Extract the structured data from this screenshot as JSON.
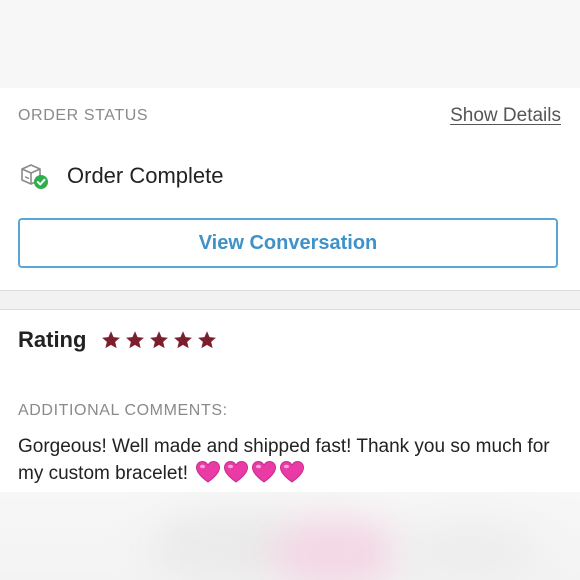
{
  "order": {
    "status_label": "ORDER STATUS",
    "show_details_label": "Show Details",
    "status_text": "Order Complete",
    "status_icon": "package-check-icon",
    "view_conversation_label": "View Conversation"
  },
  "review": {
    "rating_label": "Rating",
    "rating_value": 5,
    "rating_max": 5,
    "star_color": "#7a1f2b",
    "comments_label": "ADDITIONAL COMMENTS:",
    "comment_text": "Gorgeous! Well made and shipped fast! Thank you so much for my custom bracelet!",
    "comment_emoji": [
      "pink-heart",
      "pink-heart",
      "pink-heart",
      "pink-heart"
    ],
    "heart_color": "#e93aa6"
  },
  "colors": {
    "accent_blue": "#3f92c8",
    "success_green": "#2fae4e"
  }
}
